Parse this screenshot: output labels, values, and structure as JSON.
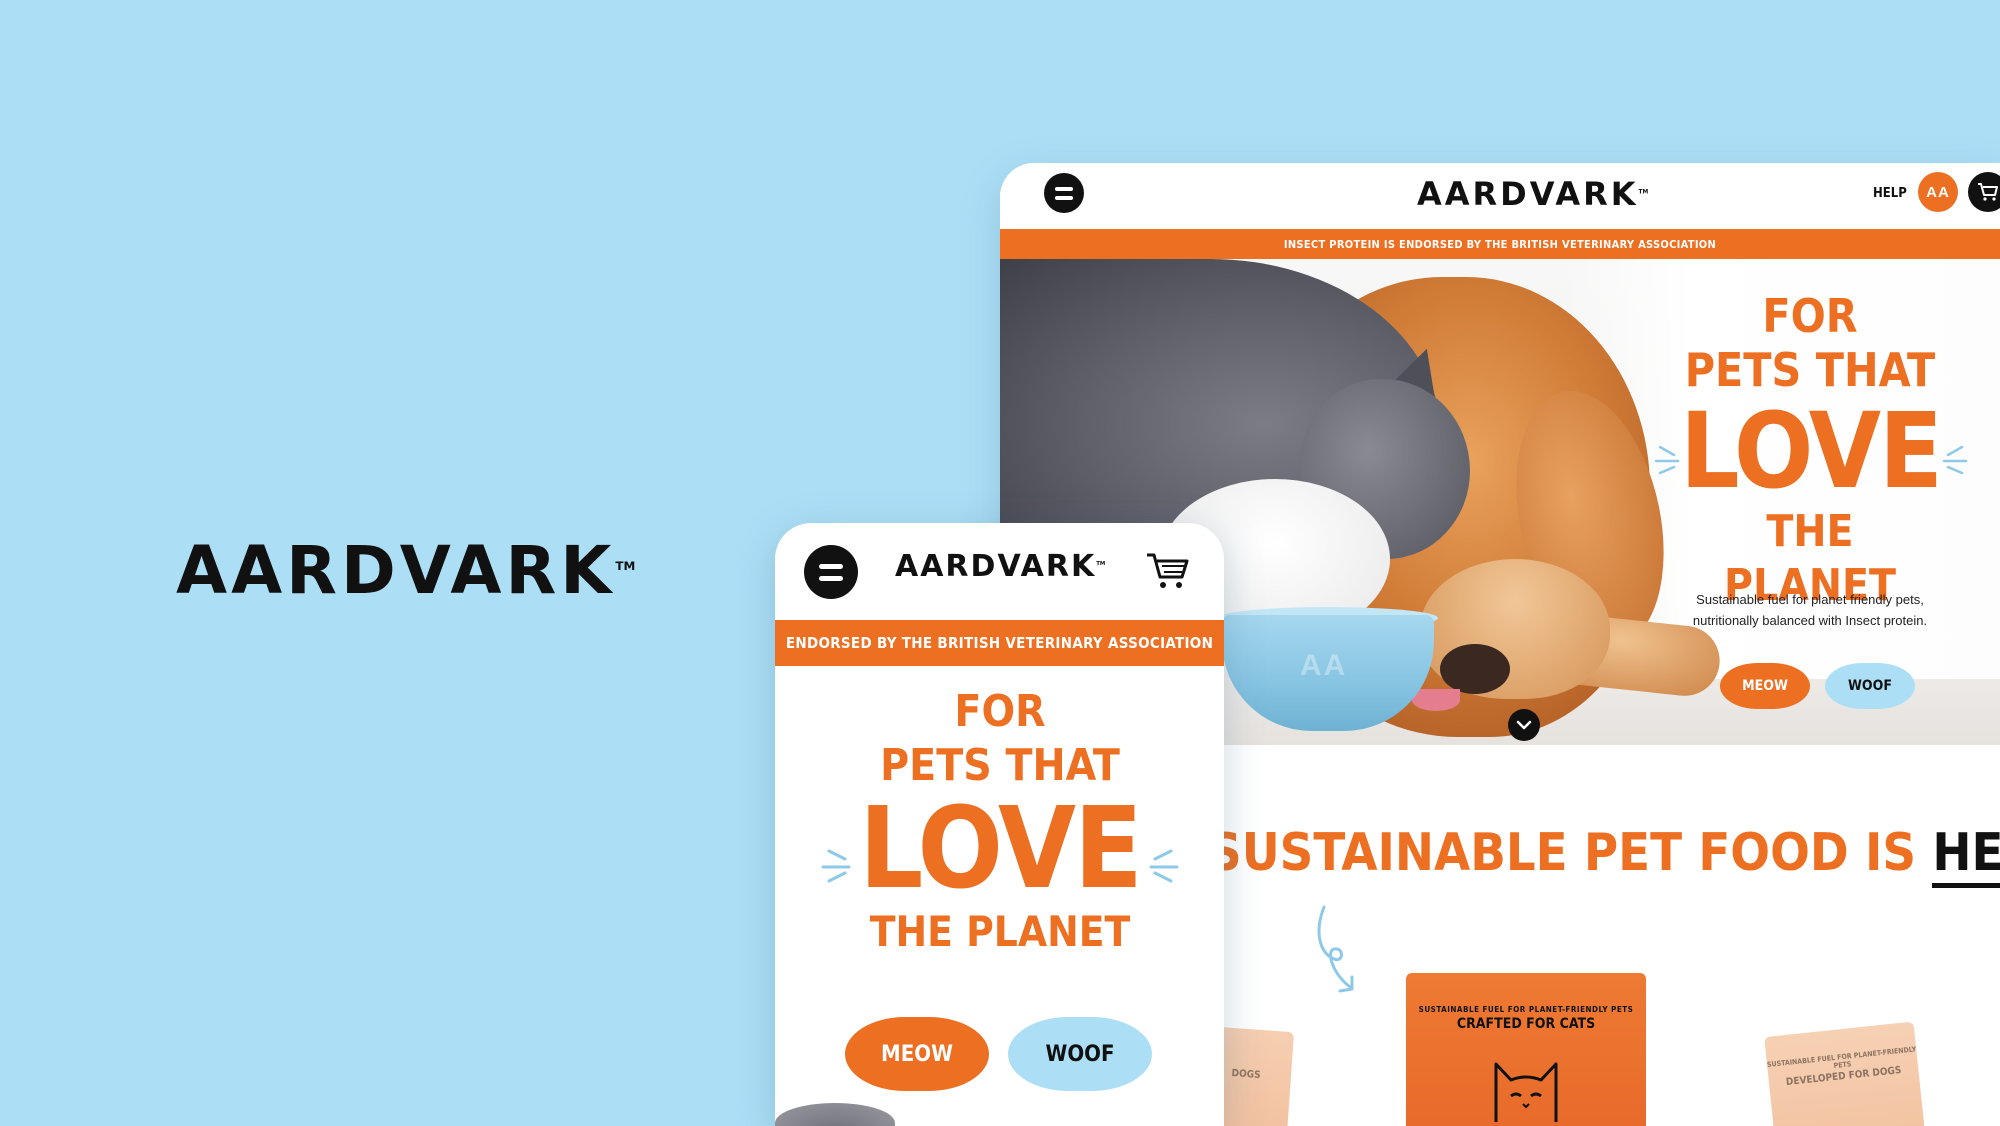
{
  "brand": {
    "name": "AARDVARK",
    "tm": "TM"
  },
  "colors": {
    "background": "#acdff6",
    "accent": "#ec6f22",
    "light_blue": "#acdff6",
    "ink": "#111111"
  },
  "desktop": {
    "header": {
      "logo": "AARDVARK",
      "tm": "TM",
      "help": "HELP",
      "account_initials": "AA",
      "menu_icon": "menu-icon",
      "cart_icon": "cart-icon"
    },
    "banner": "INSECT PROTEIN IS ENDORSED BY THE BRITISH VETERINARY ASSOCIATION",
    "hero": {
      "line1": "FOR",
      "line2": "PETS THAT",
      "line3": "LOVE",
      "line4": "THE PLANET",
      "subtitle_line1": "Sustainable fuel for planet friendly pets,",
      "subtitle_line2": "nutritionally balanced with Insect protein.",
      "cta_meow": "MEOW",
      "cta_woof": "WOOF",
      "bowl_mark": "AA"
    },
    "section": {
      "title": "SUSTAINABLE PET FOOD IS",
      "title_emphasis": "HERE",
      "products": [
        {
          "small": "SUSTAINABLE FUEL FOR PLANET-FRIENDLY PETS",
          "big": "CRAFTED FOR CATS"
        },
        {
          "small": "SUSTAINABLE FUEL FOR PLANET-FRIENDLY PETS",
          "big": "DEVELOPED FOR DOGS"
        },
        {
          "big": "DOGS"
        }
      ]
    }
  },
  "mobile": {
    "header": {
      "logo": "AARDVARK",
      "tm": "TM",
      "menu_icon": "menu-icon",
      "cart_icon": "cart-icon"
    },
    "banner": "ENDORSED BY THE BRITISH VETERINARY ASSOCIATION",
    "hero": {
      "line1": "FOR",
      "line2": "PETS THAT",
      "line3": "LOVE",
      "line4": "THE PLANET",
      "cta_meow": "MEOW",
      "cta_woof": "WOOF"
    }
  }
}
